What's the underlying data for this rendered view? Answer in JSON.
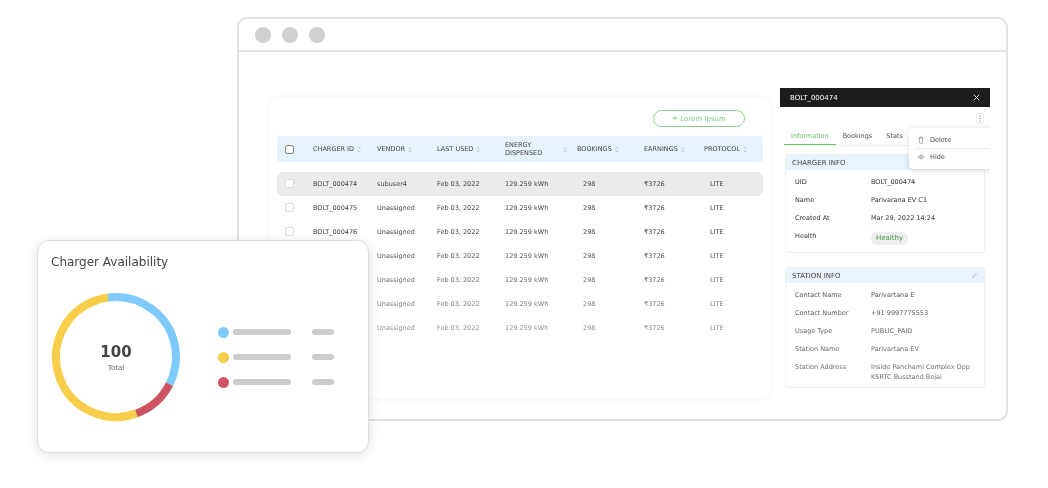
{
  "table": {
    "action_button": "Lorem Ipsum",
    "select_all_checked": false,
    "columns": [
      "CHARGER ID",
      "VENDOR",
      "LAST USED",
      "ENERGY DISPENSED",
      "BOOKINGS",
      "EARNINGS",
      "PROTOCOL"
    ],
    "rows": [
      {
        "selected": true,
        "charger_id": "BOLT_000474",
        "vendor": "subuser4",
        "last_used": "Feb 03, 2022",
        "energy": "129.259 kWh",
        "bookings": "298",
        "earnings": "₹3726",
        "protocol": "LITE"
      },
      {
        "selected": false,
        "charger_id": "BOLT_000475",
        "vendor": "Unassigned",
        "last_used": "Feb 03, 2022",
        "energy": "129.259 kWh",
        "bookings": "298",
        "earnings": "₹3726",
        "protocol": "LITE"
      },
      {
        "selected": false,
        "charger_id": "BOLT_000476",
        "vendor": "Unassigned",
        "last_used": "Feb 03, 2022",
        "energy": "129.259 kWh",
        "bookings": "298",
        "earnings": "₹3726",
        "protocol": "LITE"
      },
      {
        "selected": false,
        "vendor": "Unassigned",
        "last_used": "Feb 03, 2022",
        "energy": "129.259 kWh",
        "bookings": "298",
        "earnings": "₹3726",
        "protocol": "LITE"
      },
      {
        "selected": false,
        "vendor": "Unassigned",
        "last_used": "Feb 03, 2022",
        "energy": "129.259 kWh",
        "bookings": "298",
        "earnings": "₹3726",
        "protocol": "LITE"
      },
      {
        "selected": false,
        "vendor": "Unassigned",
        "last_used": "Feb 03, 2022",
        "energy": "129.259 kWh",
        "bookings": "298",
        "earnings": "₹3726",
        "protocol": "LITE"
      },
      {
        "selected": false,
        "vendor": "Unassigned",
        "last_used": "Feb 03, 2022",
        "energy": "129.259 kWh",
        "bookings": "298",
        "earnings": "₹3726",
        "protocol": "LITE"
      }
    ]
  },
  "detail_panel": {
    "title": "BOLT_000474",
    "tabs": [
      {
        "label": "Information",
        "selected": true
      },
      {
        "label": "Bookings",
        "selected": false
      },
      {
        "label": "Stats",
        "selected": false
      }
    ],
    "menu": [
      {
        "label": "Delete",
        "kind": "delete"
      },
      {
        "label": "Hide",
        "kind": "hide"
      }
    ],
    "charger_info": {
      "heading": "CHARGER INFO",
      "fields": [
        {
          "label": "UID",
          "value": "BOLT_000474",
          "kind": "text"
        },
        {
          "label": "Name",
          "value": "Parivarana EV C1",
          "kind": "text"
        },
        {
          "label": "Created At",
          "value": "Mar 29, 2022 14:24",
          "kind": "text"
        },
        {
          "label": "Health",
          "value": "Healthy",
          "kind": "badge"
        }
      ]
    },
    "station_info": {
      "heading": "STATION INFO",
      "fields": [
        {
          "label": "Contact Name",
          "value": "Parivartana E",
          "kind": "text"
        },
        {
          "label": "Contact Number",
          "value": "+91 9997775553",
          "kind": "text"
        },
        {
          "label": "Usage Type",
          "value": "PUBLIC_PAID",
          "kind": "text"
        },
        {
          "label": "Station Name",
          "value": "Parivartana EV",
          "kind": "text"
        },
        {
          "label": "Station Address",
          "value": "Inside Panchami Complex Opp KSRTC Busstand Bejai",
          "kind": "text"
        }
      ]
    }
  },
  "availability_card": {
    "title": "Charger Availability",
    "total": "100",
    "total_label": "Total",
    "legend": [
      {
        "color": "#7ecbfb"
      },
      {
        "color": "#f7cd4a"
      },
      {
        "color": "#cf5462"
      }
    ]
  }
}
